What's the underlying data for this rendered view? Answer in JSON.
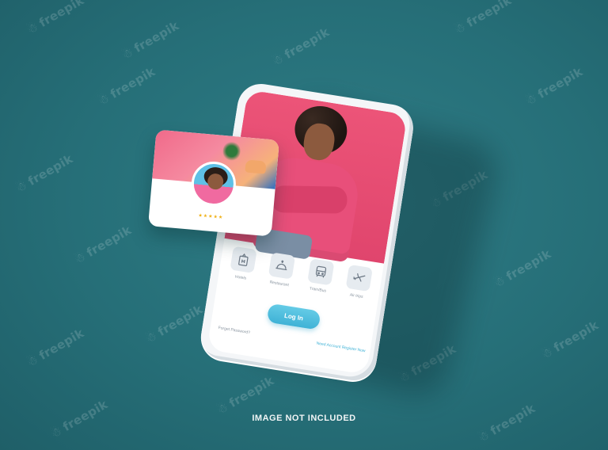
{
  "watermark": "freepik",
  "phone": {
    "menu": [
      {
        "label": "Hotels",
        "icon": "hotel-icon"
      },
      {
        "label": "Restaurant",
        "icon": "restaurant-icon"
      },
      {
        "label": "Train/Bus",
        "icon": "bus-icon"
      },
      {
        "label": "Air trips",
        "icon": "airplane-icon"
      }
    ],
    "login_label": "Log In",
    "forgot_password": "Forget Password?",
    "signup_prompt": "Need Account Register Now"
  },
  "card": {
    "rating": "★★★★★"
  },
  "caption": "IMAGE NOT INCLUDED",
  "colors": {
    "background": "#266f78",
    "accent": "#3fb2d6",
    "photo_bg": "#e0456d",
    "star": "#f0b21a"
  }
}
